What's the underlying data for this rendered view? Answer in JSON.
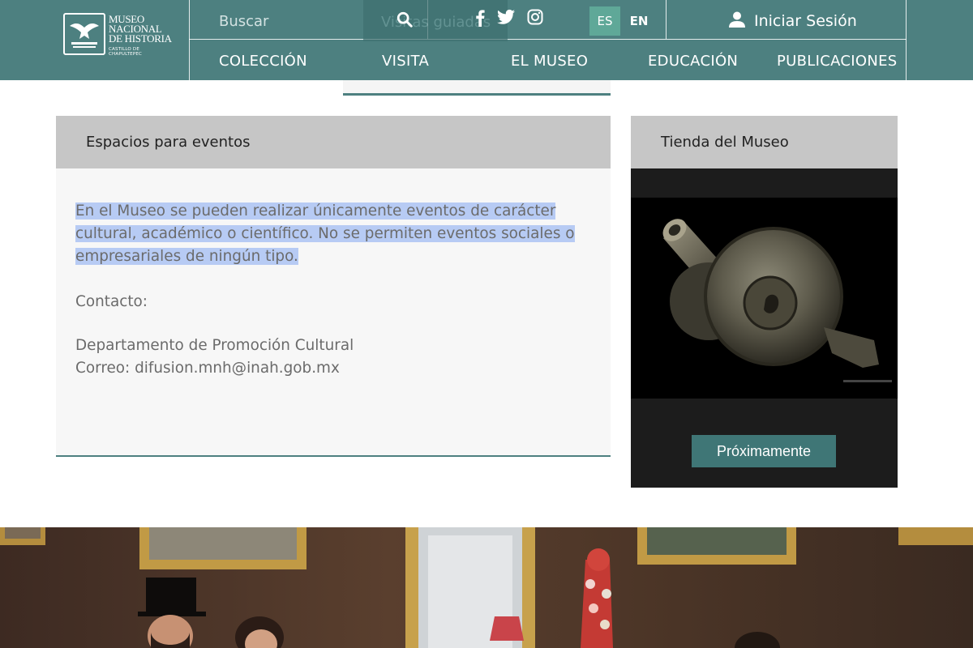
{
  "header": {
    "logo": {
      "line1": "MUSEO",
      "line2": "NACIONAL",
      "line3": "DE HISTORIA",
      "subtitle": "CASTILLO DE CHAPULTEPEC"
    },
    "search": {
      "placeholder": "Buscar",
      "value": "",
      "icon": "search-icon"
    },
    "ghost_tab_label": "Visitas guiadas",
    "social": [
      {
        "name": "facebook-icon"
      },
      {
        "name": "twitter-icon"
      },
      {
        "name": "instagram-icon"
      }
    ],
    "languages": {
      "es": "ES",
      "en": "EN",
      "active": "ES"
    },
    "login": {
      "label": "Iniciar Sesión",
      "icon": "user-icon"
    },
    "nav": [
      "COLECCIÓN",
      "VISITA",
      "EL MUSEO",
      "EDUCACIÓN",
      "PUBLICACIONES"
    ]
  },
  "events_panel": {
    "title": "Espacios para eventos",
    "paragraph": "En el Museo se pueden realizar únicamente eventos de carácter cultural, académico o científico. No se permiten eventos sociales o empresariales de ningún tipo.",
    "contact_label": "Contacto:",
    "department": "Departamento de Promoción Cultural",
    "email": "Correo: difusion.mnh@inah.gob.mx"
  },
  "shop_panel": {
    "title": "Tienda del Museo",
    "button_label": "Próximamente"
  },
  "colors": {
    "header_bg": "#4d8080",
    "accent": "#3f7676",
    "lang_active_bg": "#5fa898",
    "highlight": "#b7cbf4"
  }
}
